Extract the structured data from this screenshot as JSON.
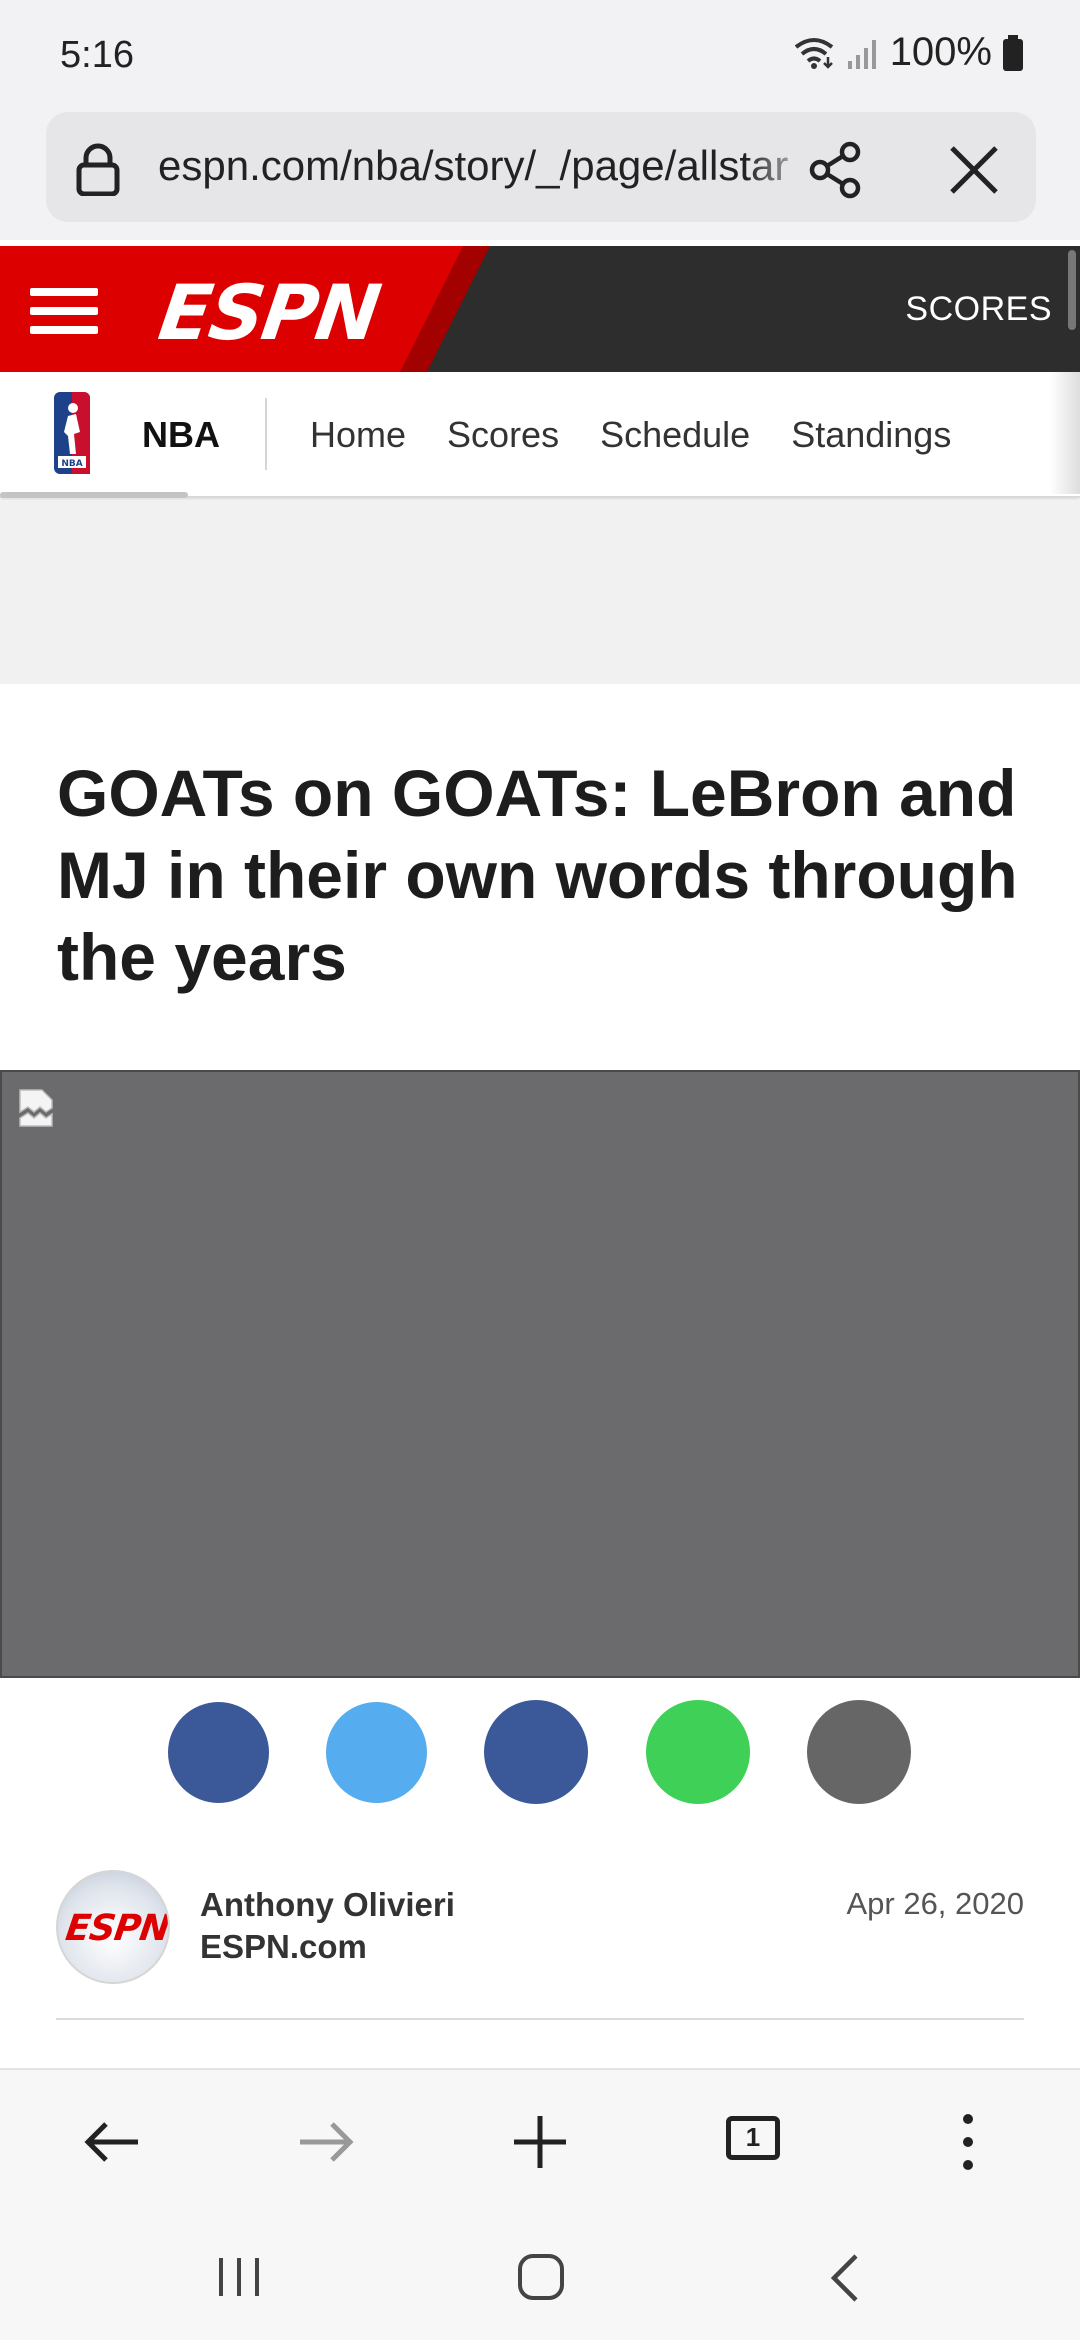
{
  "status_bar": {
    "time": "5:16",
    "battery": "100%",
    "icons": [
      "wifi-icon",
      "signal-icon",
      "battery-icon"
    ]
  },
  "browser": {
    "url": "espn.com/nba/story/_/page/allstar",
    "icons": [
      "lock-icon",
      "share-icon",
      "close-icon"
    ],
    "progress_gradient": [
      "#6a5bd8",
      "#c8327a",
      "#f04b3a",
      "#f59a1a"
    ]
  },
  "header": {
    "logo": "ESPN",
    "scores_label": "SCORES",
    "brand_color": "#dd0000"
  },
  "sub_nav": {
    "league": "NBA",
    "links": [
      "Home",
      "Scores",
      "Schedule",
      "Standings"
    ]
  },
  "article": {
    "headline": "GOATs on GOATs: LeBron and MJ in their own words through the years",
    "share_buttons": [
      {
        "name": "facebook",
        "color": "#3b5998"
      },
      {
        "name": "twitter",
        "color": "#55acee"
      },
      {
        "name": "messenger",
        "color": "#3b5998"
      },
      {
        "name": "whatsapp",
        "color": "#3fd157"
      },
      {
        "name": "email",
        "color": "#666666"
      }
    ],
    "author": "Anthony Olivieri",
    "source": "ESPN.com",
    "date": "Apr 26, 2020",
    "avatar_logo": "ESPN"
  },
  "toolbar": {
    "tab_count": "1",
    "icons": [
      "back-arrow-icon",
      "forward-arrow-icon",
      "new-tab-plus-icon",
      "tabs-icon",
      "more-menu-icon"
    ]
  },
  "system_nav": {
    "icons": [
      "recent-apps-icon",
      "home-icon",
      "back-icon"
    ]
  }
}
